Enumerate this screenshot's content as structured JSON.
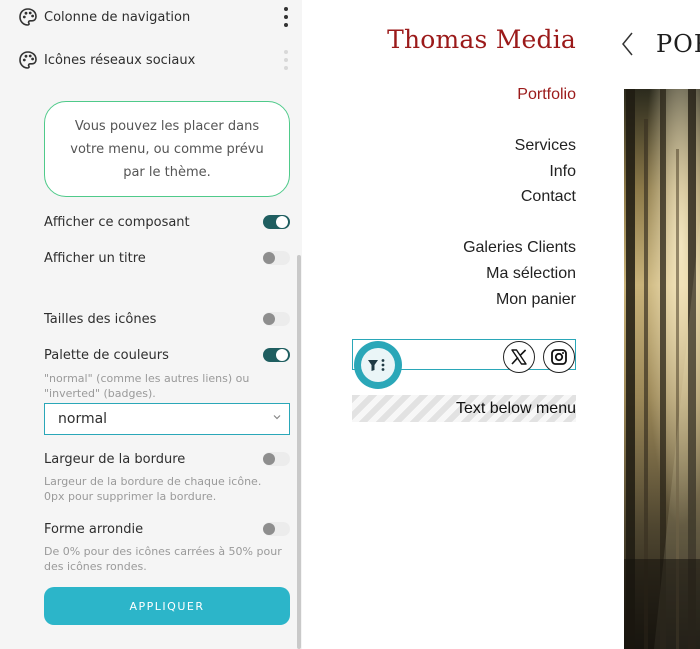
{
  "panel": {
    "nav_rows": [
      {
        "label": "Colonne de navigation",
        "icon": "palette-icon"
      },
      {
        "label": "Icônes réseaux sociaux",
        "icon": "palette-icon"
      }
    ],
    "info_text": "Vous pouvez les placer dans votre menu, ou comme prévu par le thème.",
    "options": {
      "show_component": {
        "label": "Afficher ce composant",
        "on": true
      },
      "show_title": {
        "label": "Afficher un titre",
        "on": false
      },
      "icon_sizes": {
        "label": "Tailles des icônes",
        "on": false
      },
      "color_palette": {
        "label": "Palette de couleurs",
        "on": true,
        "help": "\"normal\" (comme les autres liens) ou \"inverted\" (badges)."
      },
      "border_width": {
        "label": "Largeur de la bordure",
        "on": false,
        "help": "Largeur de la bordure de chaque icône. 0px pour supprimer la bordure."
      },
      "rounded_shape": {
        "label": "Forme arrondie",
        "on": false,
        "help": "De 0% pour des icônes carrées à 50% pour des icônes rondes."
      }
    },
    "palette_select": {
      "value": "normal"
    },
    "apply_label": "APPLIQUER"
  },
  "site": {
    "title": "Thomas Media",
    "menu": {
      "portfolio": "Portfolio",
      "services": "Services",
      "info": "Info",
      "contact": "Contact",
      "client_galleries": "Galeries Clients",
      "my_selection": "Ma sélection",
      "my_cart": "Mon panier"
    },
    "social_icons": [
      "x-twitter-icon",
      "instagram-icon"
    ],
    "text_below_menu": "Text below menu",
    "page_heading": "POR"
  },
  "colors": {
    "brand_red": "#9b1a1a",
    "accent_teal": "#2aa7b8",
    "toggle_on": "#1f5e60",
    "info_border": "#4fca8a",
    "apply_button": "#2cb5c9"
  }
}
